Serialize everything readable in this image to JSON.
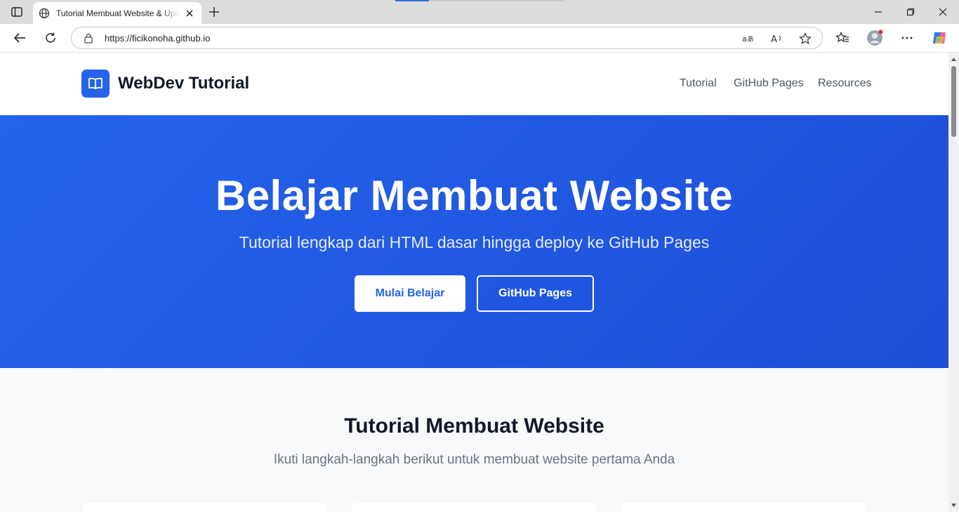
{
  "browser": {
    "tab": {
      "title": "Tutorial Membuat Website & Upload ke GitHub Pages"
    },
    "address_bar": {
      "url": "https://ficikonoha.github.io"
    }
  },
  "site": {
    "logo_text": "WebDev Tutorial",
    "nav": [
      "Tutorial",
      "GitHub Pages",
      "Resources"
    ]
  },
  "hero": {
    "title": "Belajar Membuat Website",
    "subtitle": "Tutorial lengkap dari HTML dasar hingga deploy ke GitHub Pages",
    "primary_button": "Mulai Belajar",
    "secondary_button": "GitHub Pages"
  },
  "tutorial_section": {
    "title": "Tutorial Membuat Website",
    "subtitle": "Ikuti langkah-langkah berikut untuk membuat website pertama Anda"
  },
  "colors": {
    "brand": "#2563eb",
    "hero_gradient_end": "#1d4ed8"
  }
}
